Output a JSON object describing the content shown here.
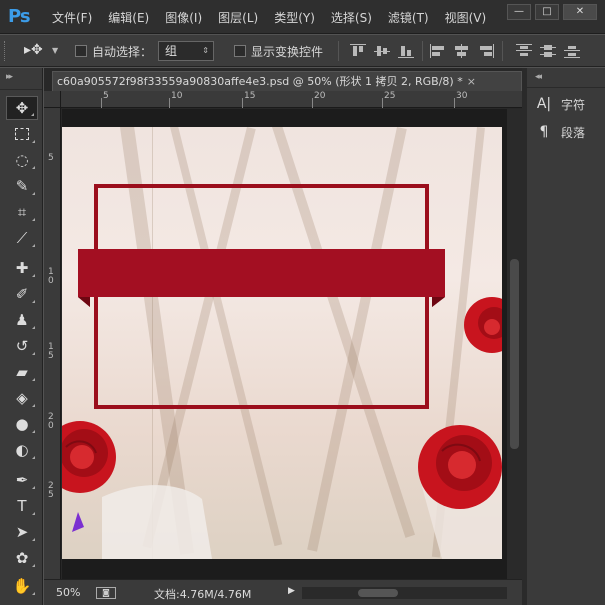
{
  "app": {
    "logo": "Ps",
    "menu": [
      "文件(F)",
      "编辑(E)",
      "图像(I)",
      "图层(L)",
      "类型(Y)",
      "选择(S)",
      "滤镜(T)",
      "视图(V)"
    ],
    "window_controls": {
      "minimize": "—",
      "maximize": "□",
      "close": "✕"
    }
  },
  "options_bar": {
    "auto_select_label": "自动选择：",
    "auto_select_value": "组",
    "show_transform_label": "显示变换控件"
  },
  "document": {
    "tab_title": "c60a905572f98f33559a90830affe4e3.psd @ 50% (形状 1 拷贝 2, RGB/8) *",
    "close_glyph": "×",
    "ruler_h_labels": [
      "5",
      "10",
      "15",
      "20",
      "25",
      "30"
    ],
    "ruler_v_labels": [
      "5",
      "1\n0",
      "1\n5",
      "2\n0",
      "2\n5"
    ]
  },
  "status": {
    "zoom": "50%",
    "doc_info": "文档:4.76M/4.76M"
  },
  "right_panel": {
    "items": [
      {
        "icon": "character-icon",
        "label": "字符"
      },
      {
        "icon": "paragraph-icon",
        "label": "段落"
      }
    ]
  },
  "colors": {
    "frame": "#9b0e1c",
    "banner": "#a30f22",
    "rose": "#c8141e",
    "ps_blue": "#3c9ce8"
  }
}
